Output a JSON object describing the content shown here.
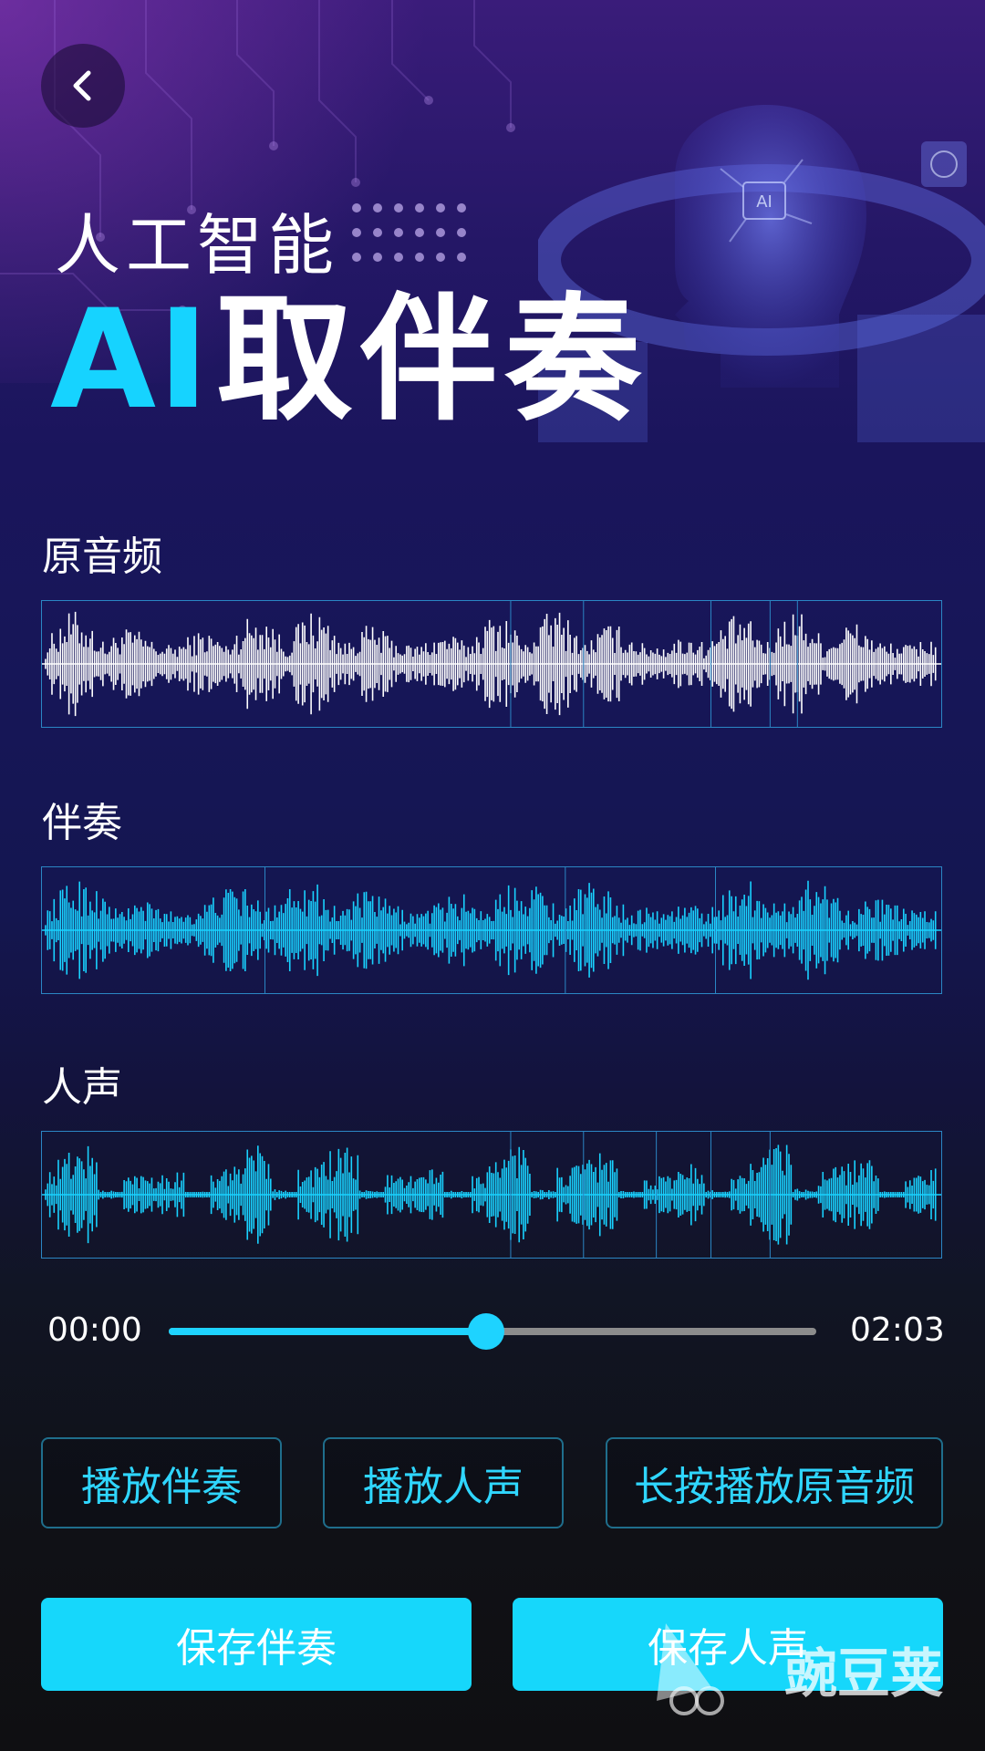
{
  "header": {
    "back_icon": "chevron-left-icon",
    "subtitle": "人工智能",
    "title_ai": "AI",
    "title_rest": "取伴奏"
  },
  "tracks": [
    {
      "label": "原音频",
      "color": "#ffffff"
    },
    {
      "label": "伴奏",
      "color": "#19d2ff"
    },
    {
      "label": "人声",
      "color": "#19d2ff"
    }
  ],
  "player": {
    "current_time": "00:00",
    "total_time": "02:03",
    "progress": 0.49
  },
  "actions": {
    "play_accompaniment": "播放伴奏",
    "play_vocals": "播放人声",
    "long_press_original": "长按播放原音频",
    "save_accompaniment": "保存伴奏",
    "save_vocals": "保存人声"
  },
  "watermark": {
    "text": "豌豆荚"
  },
  "colors": {
    "accent": "#16d7fb",
    "border": "#2b86c4"
  }
}
